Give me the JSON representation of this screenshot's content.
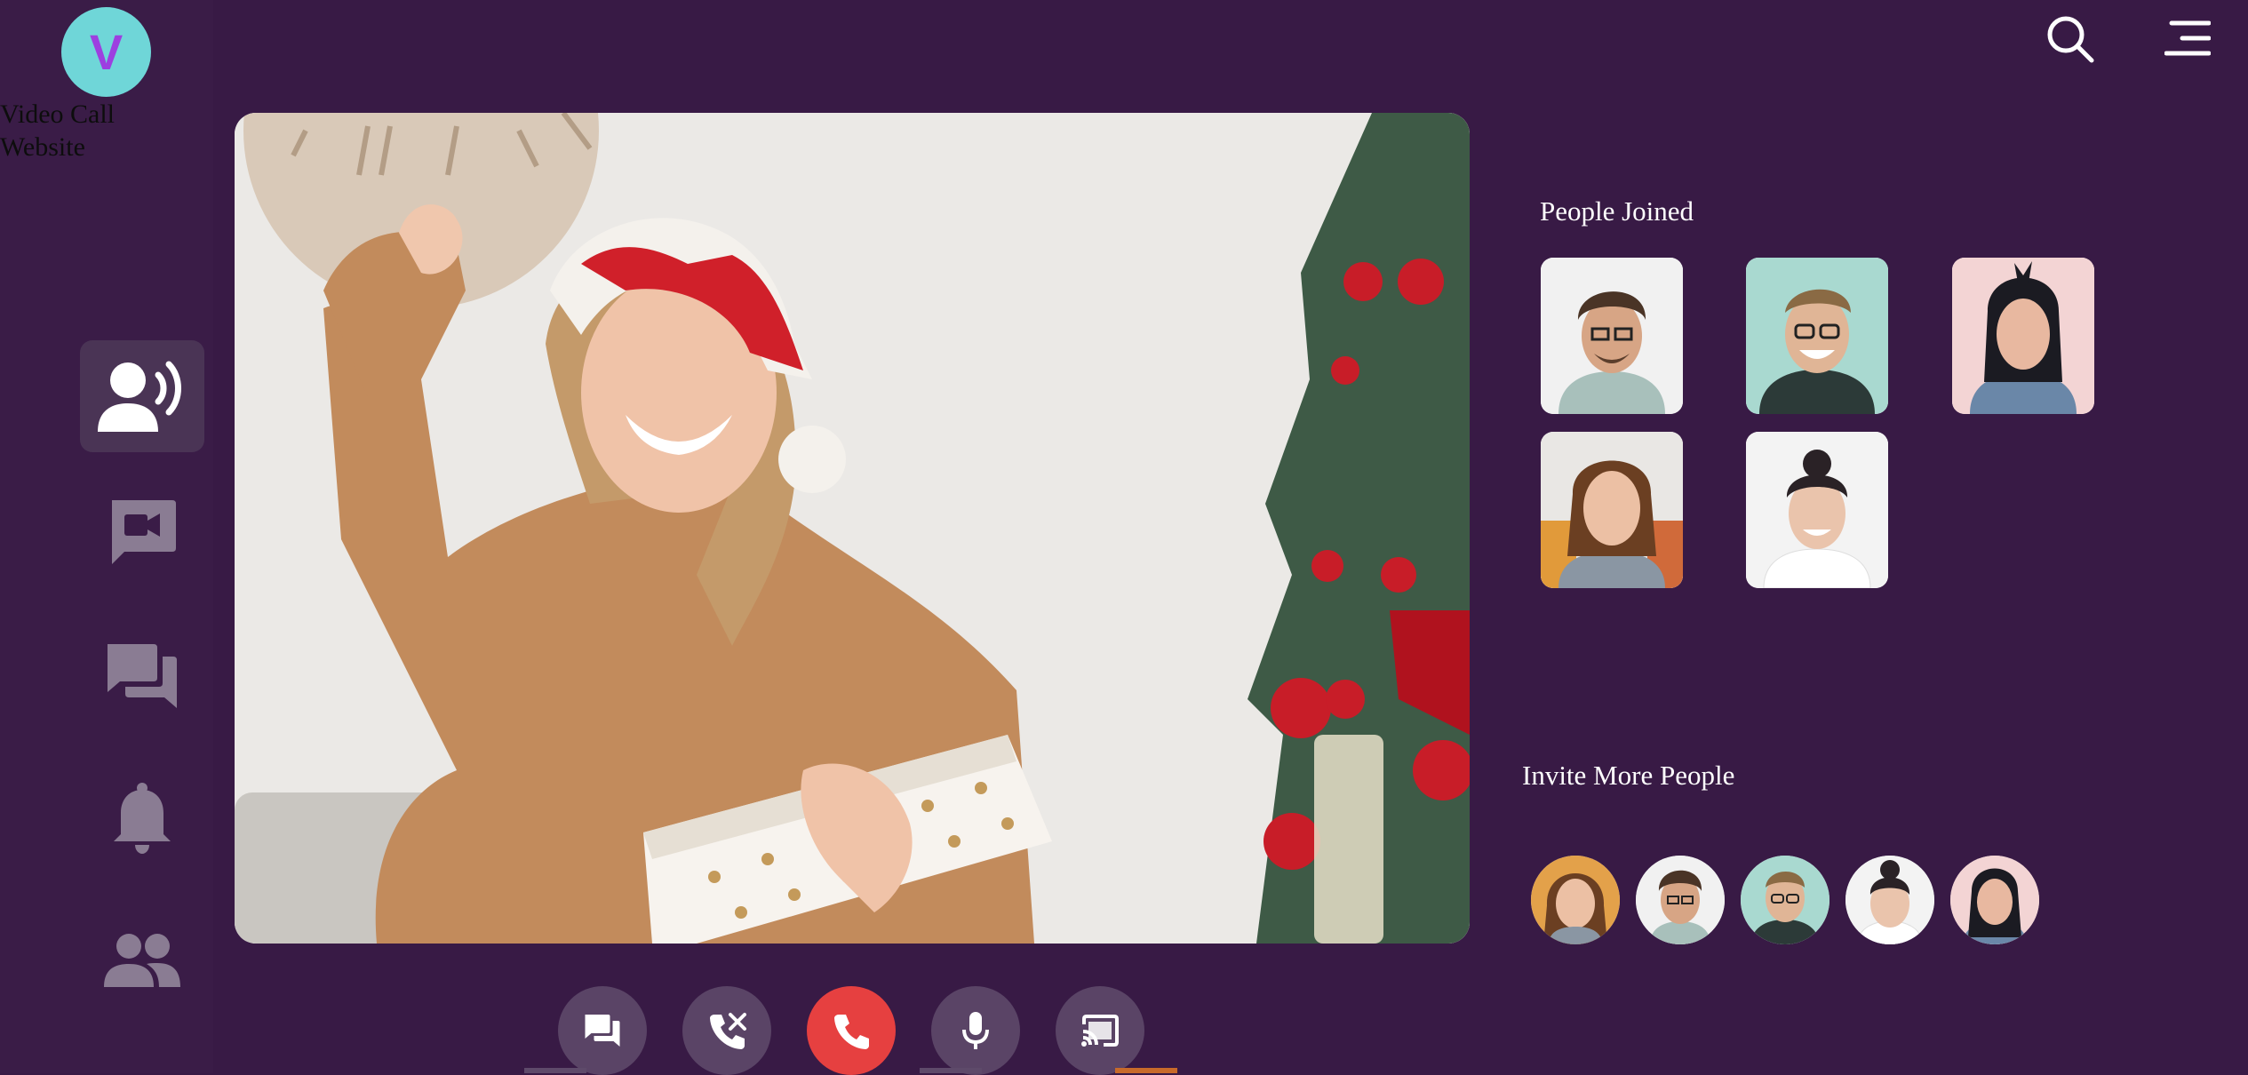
{
  "app": {
    "logo_letter": "V",
    "brand_name": "Video Call Website"
  },
  "sidebar": {
    "items": [
      {
        "icon": "voice-chat-icon",
        "active": true
      },
      {
        "icon": "video-message-icon",
        "active": false
      },
      {
        "icon": "chat-icon",
        "active": false
      },
      {
        "icon": "bell-icon",
        "active": false
      },
      {
        "icon": "people-icon",
        "active": false
      }
    ]
  },
  "header": {
    "search_icon": "search-icon",
    "menu_icon": "menu-icon"
  },
  "main_video": {
    "description_icon": "video-feed"
  },
  "people_joined": {
    "title": "People Joined",
    "participants": [
      {
        "id": 1
      },
      {
        "id": 2
      },
      {
        "id": 3
      },
      {
        "id": 4
      },
      {
        "id": 5
      }
    ]
  },
  "invite": {
    "title": "Invite More People",
    "people": [
      {
        "id": 1
      },
      {
        "id": 2
      },
      {
        "id": 3
      },
      {
        "id": 4
      },
      {
        "id": 5
      }
    ]
  },
  "controls": [
    {
      "icon": "chat-icon"
    },
    {
      "icon": "phone-mute-icon"
    },
    {
      "icon": "end-call-icon"
    },
    {
      "icon": "microphone-icon"
    },
    {
      "icon": "cast-icon"
    }
  ],
  "colors": {
    "background": "#381a45",
    "sidebar": "#3a1c47",
    "logo": "#6fd6d8",
    "end_call": "#e64040",
    "control": "#5a4466"
  }
}
